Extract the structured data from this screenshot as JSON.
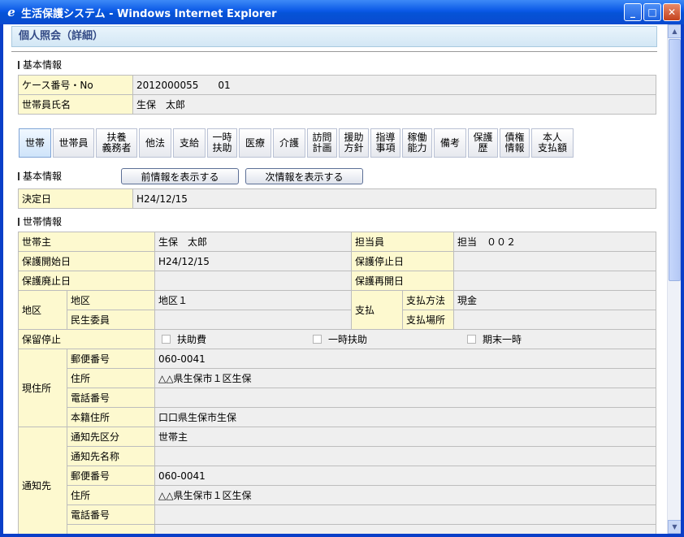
{
  "window": {
    "title": "生活保護システム - Windows Internet Explorer"
  },
  "page": {
    "title": "個人照会（詳細）"
  },
  "basic_info": {
    "section_title": "基本情報",
    "case_label": "ケース番号・No",
    "case_value": "2012000055　　01",
    "name_label": "世帯員氏名",
    "name_value": "生保　太郎"
  },
  "tabs": [
    {
      "label": "世帯"
    },
    {
      "label": "世帯員"
    },
    {
      "label": "扶養\n義務者"
    },
    {
      "label": "他法"
    },
    {
      "label": "支給"
    },
    {
      "label": "一時\n扶助"
    },
    {
      "label": "医療"
    },
    {
      "label": "介護"
    },
    {
      "label": "訪問\n計画"
    },
    {
      "label": "援助\n方針"
    },
    {
      "label": "指導\n事項"
    },
    {
      "label": "稼働\n能力"
    },
    {
      "label": "備考"
    },
    {
      "label": "保護\n歴"
    },
    {
      "label": "債権\n情報"
    },
    {
      "label": "本人\n支払額"
    }
  ],
  "basic2": {
    "section_title": "基本情報",
    "prev_btn": "前情報を表示する",
    "next_btn": "次情報を表示する",
    "decision_label": "決定日",
    "decision_value": "H24/12/15"
  },
  "household": {
    "section_title": "世帯情報",
    "head_label": "世帯主",
    "head_value": "生保　太郎",
    "staff_label": "担当員",
    "staff_value": "担当　００２",
    "start_label": "保護開始日",
    "start_value": "H24/12/15",
    "stop_label": "保護停止日",
    "stop_value": "",
    "abolish_label": "保護廃止日",
    "abolish_value": "",
    "restart_label": "保護再開日",
    "restart_value": "",
    "district_label": "地区",
    "district_sub_label": "地区",
    "district_value": "地区１",
    "commissioner_label": "民生委員",
    "commissioner_value": "",
    "payment_label": "支払",
    "pay_method_label": "支払方法",
    "pay_method_value": "現金",
    "pay_place_label": "支払場所",
    "pay_place_value": "",
    "hold_label": "保留停止",
    "hold_options": [
      "扶助費",
      "一時扶助",
      "期末一時"
    ],
    "current_addr_label": "現住所",
    "postal_label": "郵便番号",
    "postal_value": "060-0041",
    "address_label": "住所",
    "address_value": "△△県生保市１区生保",
    "phone_label": "電話番号",
    "phone_value": "",
    "domicile_label": "本籍住所",
    "domicile_value": "口口県生保市生保",
    "notify_label": "通知先",
    "notify_type_label": "通知先区分",
    "notify_type_value": "世帯主",
    "notify_name_label": "通知先名称",
    "notify_name_value": "",
    "notify_postal_label": "郵便番号",
    "notify_postal_value": "060-0041",
    "notify_address_label": "住所",
    "notify_address_value": "△△県生保市１区生保",
    "notify_phone_label": "電話番号",
    "notify_phone_value": ""
  }
}
